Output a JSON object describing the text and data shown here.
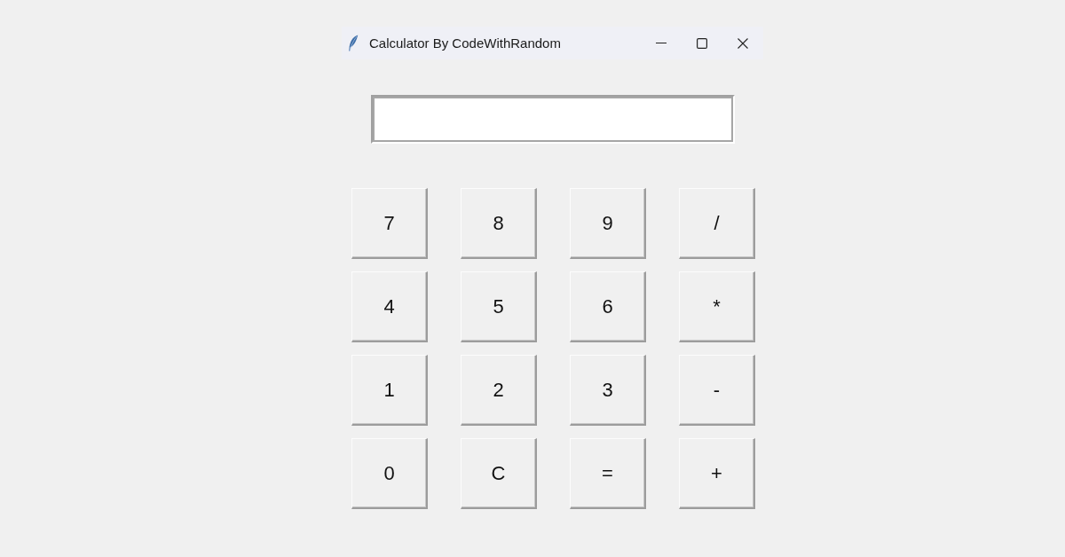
{
  "window": {
    "title": "Calculator By CodeWithRandom"
  },
  "keypad": {
    "rows": [
      [
        "7",
        "8",
        "9",
        "/"
      ],
      [
        "4",
        "5",
        "6",
        "*"
      ],
      [
        "1",
        "2",
        "3",
        "-"
      ],
      [
        "0",
        "C",
        "=",
        "+"
      ]
    ]
  }
}
